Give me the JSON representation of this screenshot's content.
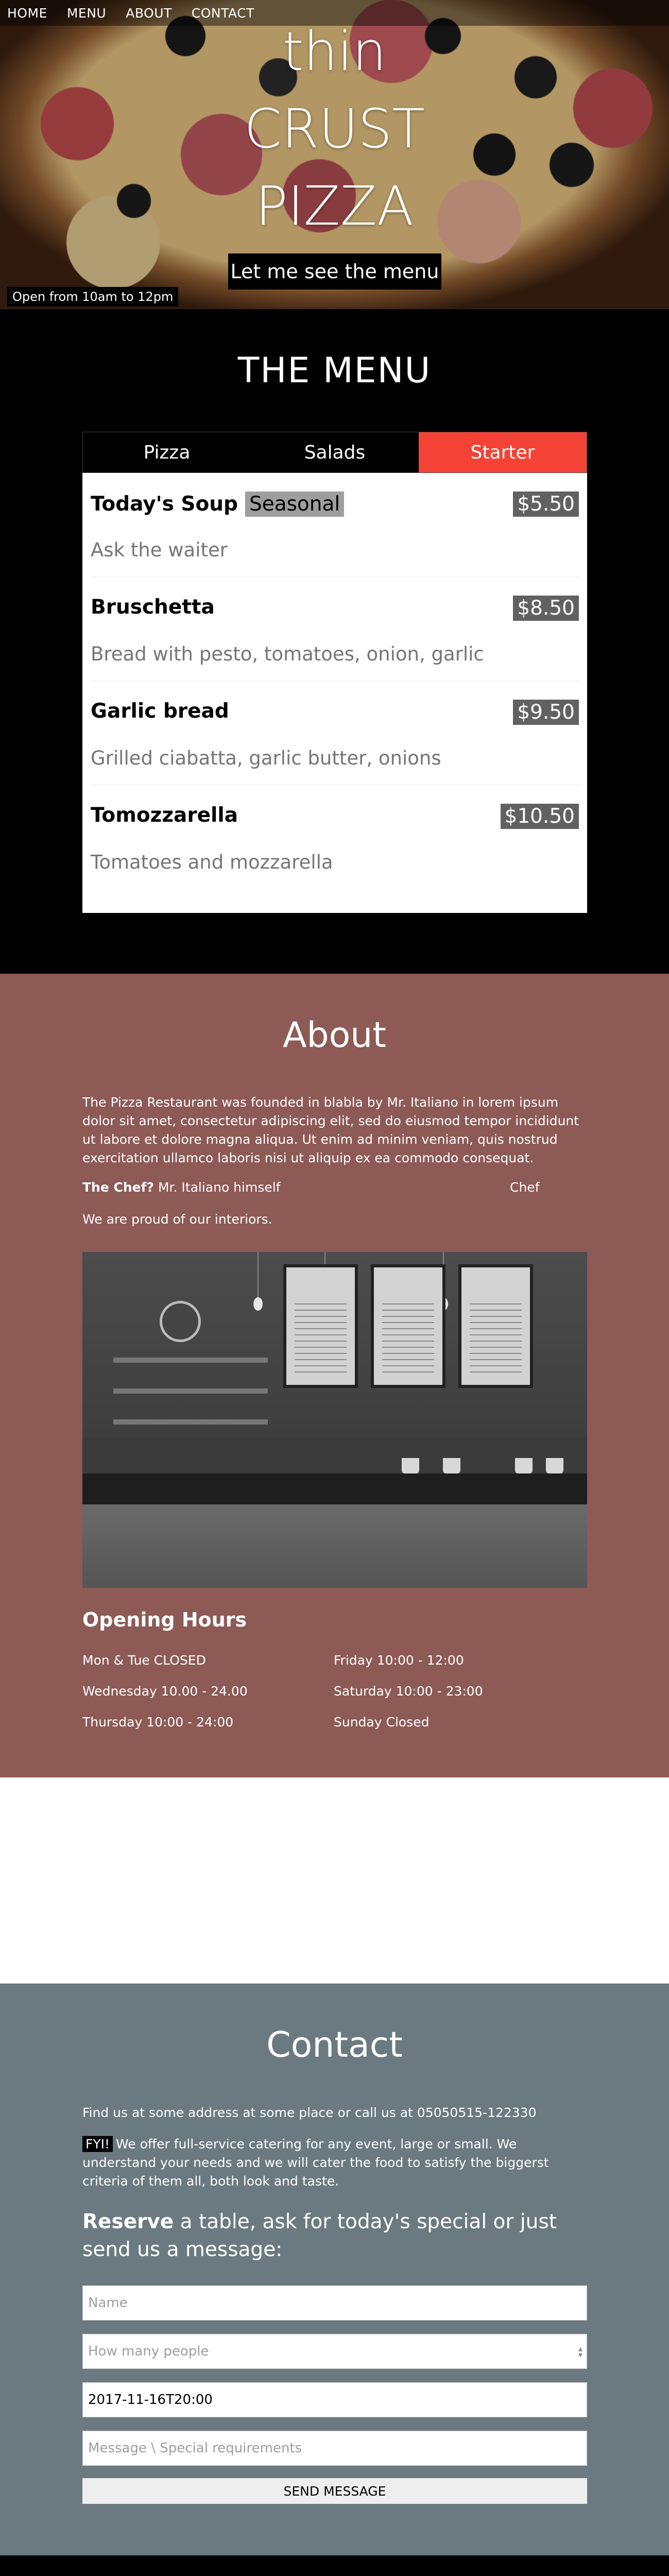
{
  "nav": {
    "items": [
      "HOME",
      "MENU",
      "ABOUT",
      "CONTACT"
    ]
  },
  "hero": {
    "title_lines": [
      "thin",
      "CRUST",
      "PIZZA"
    ],
    "button_label": "Let me see the menu",
    "hours_tag": "Open from 10am to 12pm"
  },
  "menu": {
    "heading": "THE MENU",
    "tabs": [
      {
        "label": "Pizza",
        "active": false
      },
      {
        "label": "Salads",
        "active": false
      },
      {
        "label": "Starter",
        "active": true
      }
    ],
    "items": [
      {
        "name": "Today's Soup",
        "badge": "Seasonal",
        "price": "$5.50",
        "desc": "Ask the waiter"
      },
      {
        "name": "Bruschetta",
        "price": "$8.50",
        "desc": "Bread with pesto, tomatoes, onion, garlic"
      },
      {
        "name": "Garlic bread",
        "price": "$9.50",
        "desc": "Grilled ciabatta, garlic butter, onions"
      },
      {
        "name": "Tomozzarella",
        "price": "$10.50",
        "desc": "Tomatoes and mozzarella"
      }
    ],
    "active_color": "#f44336"
  },
  "about": {
    "heading": "About",
    "paragraph": "The Pizza Restaurant was founded in blabla by Mr. Italiano in lorem ipsum dolor sit amet, consectetur adipiscing elit, sed do eiusmod tempor incididunt ut labore et dolore magna aliqua. Ut enim ad minim veniam, quis nostrud exercitation ullamco laboris nisi ut aliquip ex ea commodo consequat.",
    "chef_label": "The Chef?",
    "chef_text": " Mr. Italiano himself",
    "chef_tag": "Chef",
    "proud": "We are proud of our interiors.",
    "hours_heading": "Opening Hours",
    "hours": [
      "Mon & Tue CLOSED",
      "Friday 10:00 - 12:00",
      "Wednesday 10.00 - 24.00",
      "Saturday 10:00 - 23:00",
      "Thursday 10:00 - 24:00",
      "Sunday Closed"
    ],
    "bg_color": "#8d5a56"
  },
  "contact": {
    "heading": "Contact",
    "find": "Find us at some address at some place or call us at 05050515-122330",
    "fyi_badge": "FYI!",
    "fyi_text": "We offer full-service catering for any event, large or small. We understand your needs and we will cater the food to satisfy the biggerst criteria of them all, both look and taste.",
    "reserve_bold": "Reserve",
    "reserve_text": " a table, ask for today's special or just send us a message:",
    "fields": {
      "name_placeholder": "Name",
      "people_placeholder": "How many people",
      "datetime_value": "2017-11-16T20:00",
      "message_placeholder": "Message \\ Special requirements"
    },
    "send_label": "SEND MESSAGE",
    "bg_color": "#6b7a80"
  }
}
